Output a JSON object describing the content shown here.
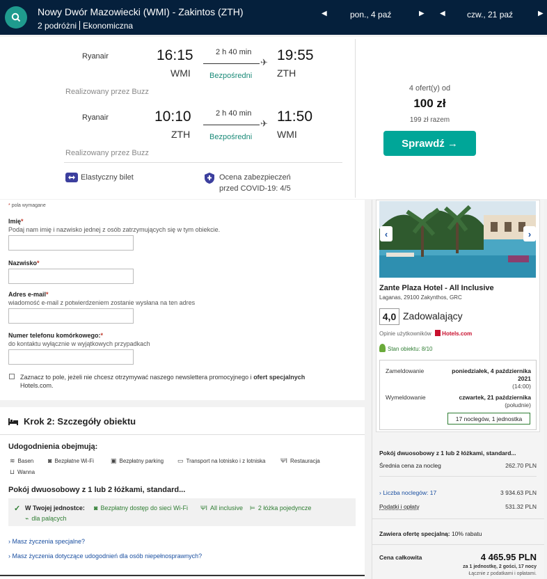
{
  "header": {
    "route": "Nowy Dwór Mazowiecki (WMI) - Zakintos (ZTH)",
    "travellers": "2 podróżni",
    "cabin": "Ekonomiczna",
    "depart_date": "pon., 4 paź",
    "return_date": "czw., 21 paź"
  },
  "flights": [
    {
      "airline": "Ryanair",
      "dep_time": "16:15",
      "dep_code": "WMI",
      "duration": "2 h 40 min",
      "stops": "Bezpośredni",
      "arr_time": "19:55",
      "arr_code": "ZTH",
      "operated": "Realizowany przez Buzz"
    },
    {
      "airline": "Ryanair",
      "dep_time": "10:10",
      "dep_code": "ZTH",
      "duration": "2 h 40 min",
      "stops": "Bezpośredni",
      "arr_time": "11:50",
      "arr_code": "WMI",
      "operated": "Realizowany przez Buzz"
    }
  ],
  "features": {
    "flexible": "Elastyczny bilet",
    "covid_line1": "Ocena zabezpieczeń",
    "covid_line2": "przed COVID-19: 4/5"
  },
  "offer": {
    "count": "4 ofert(y) od",
    "price": "100 zł",
    "total": "199 zł razem",
    "button": "Sprawdź →"
  },
  "form": {
    "required_note": "pola wymagane",
    "name_label": "Imię",
    "name_hint": "Podaj nam imię i nazwisko jednej z osób zatrzymujących się w tym obiekcie.",
    "surname_label": "Nazwisko",
    "email_label": "Adres e-mail",
    "email_hint": "wiadomość e-mail z potwierdzeniem zostanie wysłana na ten adres",
    "phone_label": "Numer telefonu komórkowego:",
    "phone_hint": "do kontaktu wyłącznie w wyjątkowych przypadkach",
    "newsletter_text": "Zaznacz to pole, jeżeli nie chcesz otrzymywać naszego newslettera promocyjnego i",
    "newsletter_bold": "ofert specjalnych",
    "newsletter_site": "Hotels.com."
  },
  "step2": {
    "title": "Krok 2: Szczegóły obiektu",
    "amenities_heading": "Udogodnienia obejmują:",
    "amenities": [
      "Basen",
      "Bezpłatne Wi-Fi",
      "Bezpłatny parking",
      "Transport na lotnisko i z lotniska",
      "Restauracja",
      "Wanna"
    ],
    "room": "Pokój dwuosobowy z 1 lub 2 łóżkami, standard...",
    "in_unit_label": "W Twojej jednostce:",
    "in_unit_items": [
      "Bezpłatny dostęp do sieci Wi-Fi",
      "All inclusive",
      "2 łóżka pojedyncze",
      "dla palących"
    ],
    "link1": "Masz życzenia specjalne?",
    "link2": "Masz życzenia dotyczące udogodnień dla osób niepełnosprawnych?"
  },
  "hotel": {
    "name": "Zante Plaza Hotel - All Inclusive",
    "address": "Laganas, 29100 Zakynthos, GRC",
    "rating": "4,0",
    "rating_text": "Zadowalający",
    "reviews_label": "Opinie użytkowników",
    "reviews_brand": "Hotels.com",
    "stan": "Stan obiektu: 8/10",
    "checkin_label": "Zameldowanie",
    "checkin_date": "poniedziałek, 4 października",
    "checkin_time": "(14:00)",
    "checkout_label": "Wymeldowanie",
    "checkout_date_1": "czwartek, 21 października",
    "checkout_date_2": "2021",
    "checkin_date_2": "2021",
    "checkout_time": "(południe)",
    "nights": "17 noclegów, 1 jednostka"
  },
  "pricing": {
    "room": "Pokój dwuosobowy z 1 lub 2 łóżkami, standard...",
    "avg_label": "Średnia cena za nocleg",
    "avg_value": "262.70 PLN",
    "nights_label": "Liczba noclegów: 17",
    "nights_value": "3 934.63 PLN",
    "tax_label": "Podatki i opłaty",
    "tax_value": "531.32 PLN",
    "special_label": "Zawiera ofertę specjalną:",
    "special_value": "10% rabatu",
    "total_label": "Cena całkowita",
    "total_value": "4 465.95 PLN",
    "total_sub": "za 1 jednostkę, 2 gości, 17 nocy",
    "total_note": "Łącznie z podatkami i opłatami."
  }
}
